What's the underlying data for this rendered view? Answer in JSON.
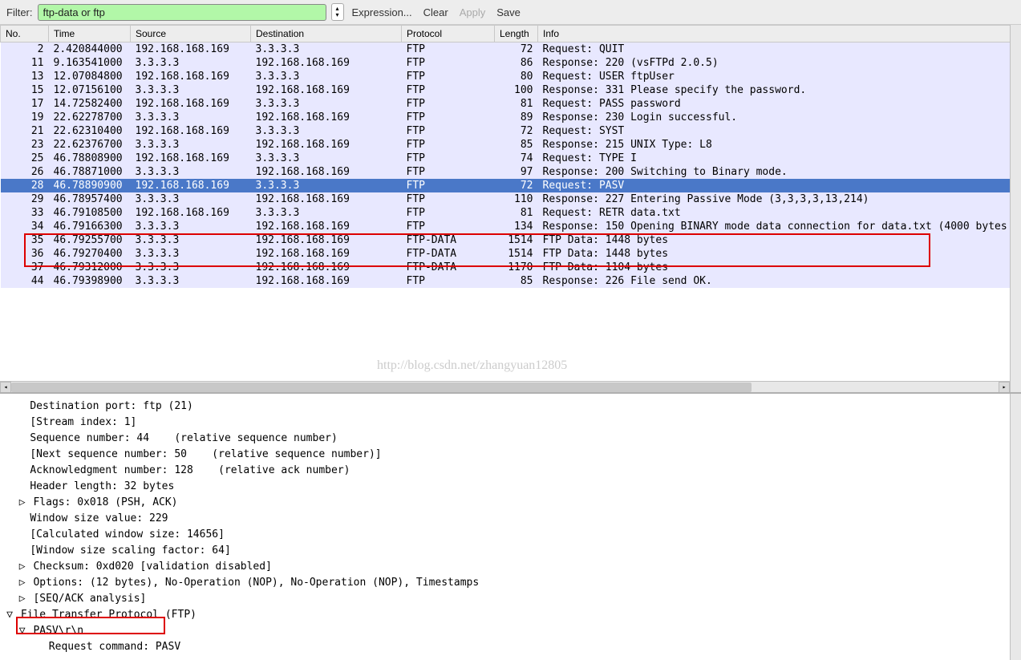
{
  "toolbar": {
    "filter_label": "Filter:",
    "filter_value": "ftp-data or ftp",
    "expression": "Expression...",
    "clear": "Clear",
    "apply": "Apply",
    "save": "Save"
  },
  "columns": {
    "no": "No.",
    "time": "Time",
    "src": "Source",
    "dst": "Destination",
    "proto": "Protocol",
    "len": "Length",
    "info": "Info"
  },
  "packets": [
    {
      "no": "2",
      "time": "2.420844000",
      "src": "192.168.168.169",
      "dst": "3.3.3.3",
      "proto": "FTP",
      "len": "72",
      "info": "Request: QUIT",
      "sel": false
    },
    {
      "no": "11",
      "time": "9.163541000",
      "src": "3.3.3.3",
      "dst": "192.168.168.169",
      "proto": "FTP",
      "len": "86",
      "info": "Response: 220 (vsFTPd 2.0.5)",
      "sel": false
    },
    {
      "no": "13",
      "time": "12.07084800",
      "src": "192.168.168.169",
      "dst": "3.3.3.3",
      "proto": "FTP",
      "len": "80",
      "info": "Request: USER ftpUser",
      "sel": false
    },
    {
      "no": "15",
      "time": "12.07156100",
      "src": "3.3.3.3",
      "dst": "192.168.168.169",
      "proto": "FTP",
      "len": "100",
      "info": "Response: 331 Please specify the password.",
      "sel": false
    },
    {
      "no": "17",
      "time": "14.72582400",
      "src": "192.168.168.169",
      "dst": "3.3.3.3",
      "proto": "FTP",
      "len": "81",
      "info": "Request: PASS password",
      "sel": false
    },
    {
      "no": "19",
      "time": "22.62278700",
      "src": "3.3.3.3",
      "dst": "192.168.168.169",
      "proto": "FTP",
      "len": "89",
      "info": "Response: 230 Login successful.",
      "sel": false
    },
    {
      "no": "21",
      "time": "22.62310400",
      "src": "192.168.168.169",
      "dst": "3.3.3.3",
      "proto": "FTP",
      "len": "72",
      "info": "Request: SYST",
      "sel": false
    },
    {
      "no": "23",
      "time": "22.62376700",
      "src": "3.3.3.3",
      "dst": "192.168.168.169",
      "proto": "FTP",
      "len": "85",
      "info": "Response: 215 UNIX Type: L8",
      "sel": false
    },
    {
      "no": "25",
      "time": "46.78808900",
      "src": "192.168.168.169",
      "dst": "3.3.3.3",
      "proto": "FTP",
      "len": "74",
      "info": "Request: TYPE I",
      "sel": false
    },
    {
      "no": "26",
      "time": "46.78871000",
      "src": "3.3.3.3",
      "dst": "192.168.168.169",
      "proto": "FTP",
      "len": "97",
      "info": "Response: 200 Switching to Binary mode.",
      "sel": false
    },
    {
      "no": "28",
      "time": "46.78890900",
      "src": "192.168.168.169",
      "dst": "3.3.3.3",
      "proto": "FTP",
      "len": "72",
      "info": "Request: PASV",
      "sel": true
    },
    {
      "no": "29",
      "time": "46.78957400",
      "src": "3.3.3.3",
      "dst": "192.168.168.169",
      "proto": "FTP",
      "len": "110",
      "info": "Response: 227 Entering Passive Mode (3,3,3,3,13,214)",
      "sel": false
    },
    {
      "no": "33",
      "time": "46.79108500",
      "src": "192.168.168.169",
      "dst": "3.3.3.3",
      "proto": "FTP",
      "len": "81",
      "info": "Request: RETR data.txt",
      "sel": false
    },
    {
      "no": "34",
      "time": "46.79166300",
      "src": "3.3.3.3",
      "dst": "192.168.168.169",
      "proto": "FTP",
      "len": "134",
      "info": "Response: 150 Opening BINARY mode data connection for data.txt (4000 bytes",
      "sel": false
    },
    {
      "no": "35",
      "time": "46.79255700",
      "src": "3.3.3.3",
      "dst": "192.168.168.169",
      "proto": "FTP-DATA",
      "len": "1514",
      "info": "FTP Data: 1448 bytes",
      "sel": false
    },
    {
      "no": "36",
      "time": "46.79270400",
      "src": "3.3.3.3",
      "dst": "192.168.168.169",
      "proto": "FTP-DATA",
      "len": "1514",
      "info": "FTP Data: 1448 bytes",
      "sel": false
    },
    {
      "no": "37",
      "time": "46.79312000",
      "src": "3.3.3.3",
      "dst": "192.168.168.169",
      "proto": "FTP-DATA",
      "len": "1170",
      "info": "FTP Data: 1104 bytes",
      "sel": false
    },
    {
      "no": "44",
      "time": "46.79398900",
      "src": "3.3.3.3",
      "dst": "192.168.168.169",
      "proto": "FTP",
      "len": "85",
      "info": "Response: 226 File send OK.",
      "sel": false
    }
  ],
  "detail": {
    "lines": [
      {
        "indent": 2,
        "tri": "",
        "text": "Destination port: ftp (21)"
      },
      {
        "indent": 2,
        "tri": "",
        "text": "[Stream index: 1]"
      },
      {
        "indent": 2,
        "tri": "",
        "text": "Sequence number: 44    (relative sequence number)"
      },
      {
        "indent": 2,
        "tri": "",
        "text": "[Next sequence number: 50    (relative sequence number)]"
      },
      {
        "indent": 2,
        "tri": "",
        "text": "Acknowledgment number: 128    (relative ack number)"
      },
      {
        "indent": 2,
        "tri": "",
        "text": "Header length: 32 bytes"
      },
      {
        "indent": 1,
        "tri": "▷",
        "text": "Flags: 0x018 (PSH, ACK)"
      },
      {
        "indent": 2,
        "tri": "",
        "text": "Window size value: 229"
      },
      {
        "indent": 2,
        "tri": "",
        "text": "[Calculated window size: 14656]"
      },
      {
        "indent": 2,
        "tri": "",
        "text": "[Window size scaling factor: 64]"
      },
      {
        "indent": 1,
        "tri": "▷",
        "text": "Checksum: 0xd020 [validation disabled]"
      },
      {
        "indent": 1,
        "tri": "▷",
        "text": "Options: (12 bytes), No-Operation (NOP), No-Operation (NOP), Timestamps"
      },
      {
        "indent": 1,
        "tri": "▷",
        "text": "[SEQ/ACK analysis]"
      },
      {
        "indent": 0,
        "tri": "▽",
        "text": "File Transfer Protocol (FTP)"
      },
      {
        "indent": 1,
        "tri": "▽",
        "text": "PASV\\r\\n"
      },
      {
        "indent": 3,
        "tri": "",
        "text": "Request command: PASV"
      }
    ]
  },
  "watermark": "http://blog.csdn.net/zhangyuan12805"
}
